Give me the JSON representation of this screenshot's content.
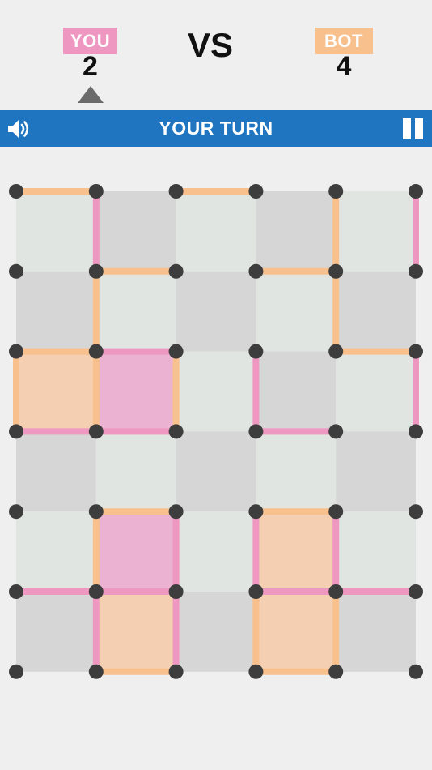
{
  "header": {
    "player_label": "YOU",
    "player_score": "2",
    "vs_label": "VS",
    "bot_label": "BOT",
    "bot_score": "4",
    "turn_text": "YOUR TURN",
    "active_player": "you"
  },
  "icons": {
    "sound": "speaker-icon",
    "pause": "pause-icon",
    "turn": "turn-indicator-triangle"
  },
  "colors": {
    "player": "#ee97c1",
    "bot": "#f7c08c",
    "bar": "#1f75c0",
    "dot": "#3d3d3d",
    "cell_light": "#e1e5e1",
    "cell_dark": "#d6d6d6",
    "box_player": "#ecb2d1",
    "box_bot": "#f5cfb1"
  },
  "board": {
    "rows": 6,
    "cols": 5,
    "h_lines": [
      [
        "bot",
        null,
        "bot",
        null,
        null
      ],
      [
        null,
        "bot",
        null,
        "bot",
        null
      ],
      [
        "bot",
        "player",
        null,
        null,
        "bot"
      ],
      [
        "player",
        "player",
        null,
        "player",
        null
      ],
      [
        null,
        "bot",
        null,
        "bot",
        null
      ],
      [
        "player",
        "player",
        null,
        "player",
        "player"
      ],
      [
        null,
        "bot",
        null,
        "bot",
        null
      ]
    ],
    "v_lines": [
      [
        null,
        "player",
        null,
        null,
        "bot",
        "player"
      ],
      [
        null,
        "bot",
        null,
        null,
        "bot",
        null
      ],
      [
        "bot",
        "bot",
        "bot",
        "player",
        null,
        "player"
      ],
      [
        null,
        null,
        null,
        null,
        null,
        null
      ],
      [
        null,
        "bot",
        "player",
        "player",
        "player",
        null
      ],
      [
        null,
        "player",
        "player",
        "bot",
        "bot",
        null
      ]
    ],
    "boxes": [
      [
        null,
        null,
        null,
        null,
        null
      ],
      [
        null,
        null,
        null,
        null,
        null
      ],
      [
        "bot",
        "player",
        null,
        null,
        null
      ],
      [
        null,
        null,
        null,
        null,
        null
      ],
      [
        null,
        "player",
        null,
        "bot",
        null
      ],
      [
        null,
        "bot",
        null,
        "bot",
        null
      ]
    ]
  }
}
